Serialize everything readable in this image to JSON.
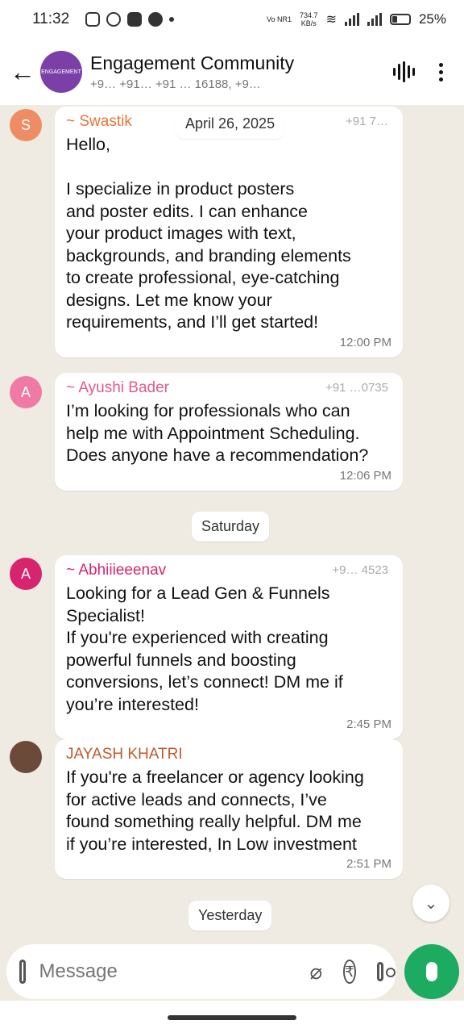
{
  "status_bar": {
    "time": "11:32",
    "net_speed_top": "734.7",
    "net_speed_bottom": "KB/s",
    "network_label": "Vo NR1",
    "battery": "25%"
  },
  "header": {
    "title": "Engagement Community",
    "subtitle": "+9…  +91…  +91 … 16188, +9…",
    "avatar_text": "ENGAGEMENT"
  },
  "chat": {
    "date_top": "April 26, 2025",
    "messages": [
      {
        "sender": "~ Swastik",
        "avatar": "S",
        "text": "Hello,\n\nI specialize in product posters\nand poster edits. I can enhance\nyour product images with text,\nbackgrounds, and branding elements\nto create professional, eye-catching\ndesigns. Let me know your\nrequirements, and I’ll get started!",
        "time": "12:00 PM",
        "phone": "+91 7…"
      },
      {
        "sender": "~ Ayushi Bader",
        "avatar": "A",
        "text": "I’m looking for professionals who can\nhelp me with Appointment Scheduling.\nDoes anyone have a recommendation?",
        "time": "12:06 PM",
        "phone": "+91 …0735"
      },
      {
        "sender": "~ Abhiiieeenav",
        "avatar": "A",
        "text": "Looking for a Lead Gen & Funnels\nSpecialist!\nIf you're experienced with creating\npowerful funnels and boosting\nconversions, let’s connect! DM me if\nyou’re interested!",
        "time": "2:45 PM",
        "phone": "+9… 4523"
      },
      {
        "sender": "JAYASH KHATRI",
        "avatar": "",
        "text": "If you're a freelancer or agency looking\nfor active leads and connects, I’ve\nfound something really helpful. DM me\nif you’re interested, In Low investment",
        "time": "2:51 PM",
        "phone": ""
      }
    ],
    "date_saturday": "Saturday",
    "date_yesterday": "Yesterday"
  },
  "composer": {
    "placeholder": "Message"
  },
  "colors": {
    "chat_bg": "#efeae2",
    "swastik": "#e8743b",
    "ayushi": "#e05a8a",
    "abhinav": "#d6246e",
    "jayash": "#c15a2e",
    "mic": "#1daa61"
  }
}
